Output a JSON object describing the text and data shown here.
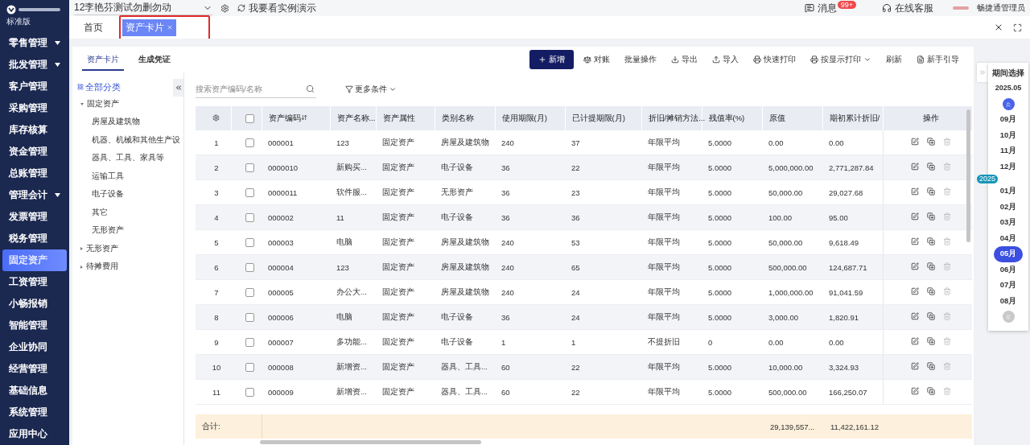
{
  "brand": {
    "edition": "标准版"
  },
  "sidebar": {
    "items": [
      {
        "label": "零售管理",
        "expandable": true,
        "selected": false
      },
      {
        "label": "批发管理",
        "expandable": true,
        "selected": false
      },
      {
        "label": "客户管理",
        "expandable": false,
        "selected": false
      },
      {
        "label": "采购管理",
        "expandable": false,
        "selected": false
      },
      {
        "label": "库存核算",
        "expandable": false,
        "selected": false
      },
      {
        "label": "资金管理",
        "expandable": false,
        "selected": false
      },
      {
        "label": "总账管理",
        "expandable": false,
        "selected": false
      },
      {
        "label": "管理会计",
        "expandable": true,
        "selected": false
      },
      {
        "label": "发票管理",
        "expandable": false,
        "selected": false
      },
      {
        "label": "税务管理",
        "expandable": false,
        "selected": false
      },
      {
        "label": "固定资产",
        "expandable": false,
        "selected": true
      },
      {
        "label": "工资管理",
        "expandable": false,
        "selected": false
      },
      {
        "label": "小畅报销",
        "expandable": false,
        "selected": false
      },
      {
        "label": "智能管理",
        "expandable": false,
        "selected": false
      },
      {
        "label": "企业协同",
        "expandable": false,
        "selected": false
      },
      {
        "label": "经营管理",
        "expandable": false,
        "selected": false
      },
      {
        "label": "基础信息",
        "expandable": false,
        "selected": false
      },
      {
        "label": "系统管理",
        "expandable": false,
        "selected": false
      },
      {
        "label": "应用中心",
        "expandable": false,
        "selected": false
      }
    ]
  },
  "topbar": {
    "company": "12李艳芬测试勿删勿动",
    "demo_link": "我要看实例演示",
    "messages": "消息",
    "message_badge": "99+",
    "support": "在线客服",
    "user": "畅捷通管理员"
  },
  "page_tabs": [
    {
      "label": "首页",
      "selected": false,
      "closable": false,
      "highlighted": false
    },
    {
      "label": "资产卡片",
      "selected": true,
      "closable": true,
      "highlighted": true
    }
  ],
  "sub_tabs": [
    {
      "label": "资产卡片",
      "selected": true
    },
    {
      "label": "生成凭证",
      "selected": false
    }
  ],
  "toolbar": [
    {
      "label": "新增",
      "kind": "primary"
    },
    {
      "label": "对账",
      "kind": "reconcile"
    },
    {
      "label": "批量操作",
      "kind": "plain"
    },
    {
      "label": "导出",
      "kind": "export"
    },
    {
      "label": "导入",
      "kind": "import"
    },
    {
      "label": "快速打印",
      "kind": "print"
    },
    {
      "label": "按显示打印",
      "kind": "print-menu"
    },
    {
      "label": "刷新",
      "kind": "plain"
    },
    {
      "label": "新手引导",
      "kind": "guide"
    }
  ],
  "tree": {
    "root": "全部分类",
    "items": [
      {
        "label": "固定资产",
        "expanded": true,
        "children": [
          {
            "label": "房屋及建筑物"
          },
          {
            "label": "机器、机械和其他生产设"
          },
          {
            "label": "器具、工具、家具等"
          },
          {
            "label": "运输工具"
          },
          {
            "label": "电子设备"
          },
          {
            "label": "其它"
          },
          {
            "label": "无形资产"
          }
        ]
      },
      {
        "label": "无形资产",
        "expanded": false
      },
      {
        "label": "待摊费用",
        "expanded": false
      }
    ]
  },
  "search": {
    "placeholder": "搜索资产编码/名称"
  },
  "filter": {
    "label": "更多条件"
  },
  "table": {
    "all_checked": false,
    "columns": [
      "资产编码",
      "资产名称...",
      "资产属性",
      "类别名称",
      "使用期限(月)",
      "已计提期限(月)",
      "折旧/摊销方法...",
      "残值率(%)",
      "原值",
      "期初累计折旧/",
      "操作"
    ],
    "rows": [
      {
        "no": "1",
        "checked": false,
        "cells": [
          "000001",
          "123",
          "固定资产",
          "房屋及建筑物",
          "240",
          "37",
          "年限平均",
          "5.0000",
          "0.00",
          "0.00"
        ]
      },
      {
        "no": "2",
        "checked": false,
        "cells": [
          "0000010",
          "新购买...",
          "固定资产",
          "电子设备",
          "36",
          "22",
          "年限平均",
          "5.0000",
          "5,000,000.00",
          "2,771,287.84"
        ]
      },
      {
        "no": "3",
        "checked": false,
        "cells": [
          "0000011",
          "软件服...",
          "固定资产",
          "无形资产",
          "36",
          "23",
          "年限平均",
          "5.0000",
          "50,000.00",
          "29,027.68"
        ]
      },
      {
        "no": "4",
        "checked": false,
        "cells": [
          "000002",
          "11",
          "固定资产",
          "电子设备",
          "36",
          "36",
          "年限平均",
          "5.0000",
          "100.00",
          "95.00"
        ]
      },
      {
        "no": "5",
        "checked": false,
        "cells": [
          "000003",
          "电脑",
          "固定资产",
          "房屋及建筑物",
          "240",
          "53",
          "年限平均",
          "5.0000",
          "50,000.00",
          "9,618.49"
        ]
      },
      {
        "no": "6",
        "checked": false,
        "cells": [
          "000004",
          "123",
          "固定资产",
          "房屋及建筑物",
          "240",
          "65",
          "年限平均",
          "5.0000",
          "500,000.00",
          "124,687.71"
        ]
      },
      {
        "no": "7",
        "checked": false,
        "cells": [
          "000005",
          "办公大...",
          "固定资产",
          "房屋及建筑物",
          "240",
          "24",
          "年限平均",
          "5.0000",
          "1,000,000.00",
          "91,041.59"
        ]
      },
      {
        "no": "8",
        "checked": false,
        "cells": [
          "000006",
          "电脑",
          "固定资产",
          "电子设备",
          "36",
          "24",
          "年限平均",
          "5.0000",
          "3,000.00",
          "1,820.91"
        ]
      },
      {
        "no": "9",
        "checked": false,
        "cells": [
          "000007",
          "多功能...",
          "固定资产",
          "电子设备",
          "1",
          "1",
          "不提折旧",
          "0",
          "0.00",
          "0.00"
        ]
      },
      {
        "no": "10",
        "checked": false,
        "cells": [
          "000008",
          "新增资...",
          "固定资产",
          "器具、工具...",
          "60",
          "22",
          "年限平均",
          "5.0000",
          "10,000.00",
          "3,324.93"
        ]
      },
      {
        "no": "11",
        "checked": false,
        "cells": [
          "000009",
          "新增资...",
          "固定资产",
          "器具、工具...",
          "60",
          "22",
          "年限平均",
          "5.0000",
          "500,000.00",
          "166,250.07"
        ]
      }
    ],
    "total": {
      "label": "合计:",
      "original": "29,139,557...",
      "opening": "11,422,161.12"
    }
  },
  "period": {
    "title": "期间选择",
    "current": "2025.05",
    "months": [
      {
        "label": "09月",
        "kind": "month",
        "selected": false
      },
      {
        "label": "10月",
        "kind": "month",
        "selected": false
      },
      {
        "label": "11月",
        "kind": "month",
        "selected": false
      },
      {
        "label": "12月",
        "kind": "month",
        "selected": false
      },
      {
        "label": "2025",
        "kind": "year",
        "selected": false
      },
      {
        "label": "01月",
        "kind": "month",
        "selected": false
      },
      {
        "label": "02月",
        "kind": "month",
        "selected": false
      },
      {
        "label": "03月",
        "kind": "month",
        "selected": false
      },
      {
        "label": "04月",
        "kind": "month",
        "selected": false
      },
      {
        "label": "05月",
        "kind": "month",
        "selected": true
      },
      {
        "label": "06月",
        "kind": "month",
        "selected": false
      },
      {
        "label": "07月",
        "kind": "month",
        "selected": false
      },
      {
        "label": "08月",
        "kind": "month",
        "selected": false
      }
    ]
  }
}
